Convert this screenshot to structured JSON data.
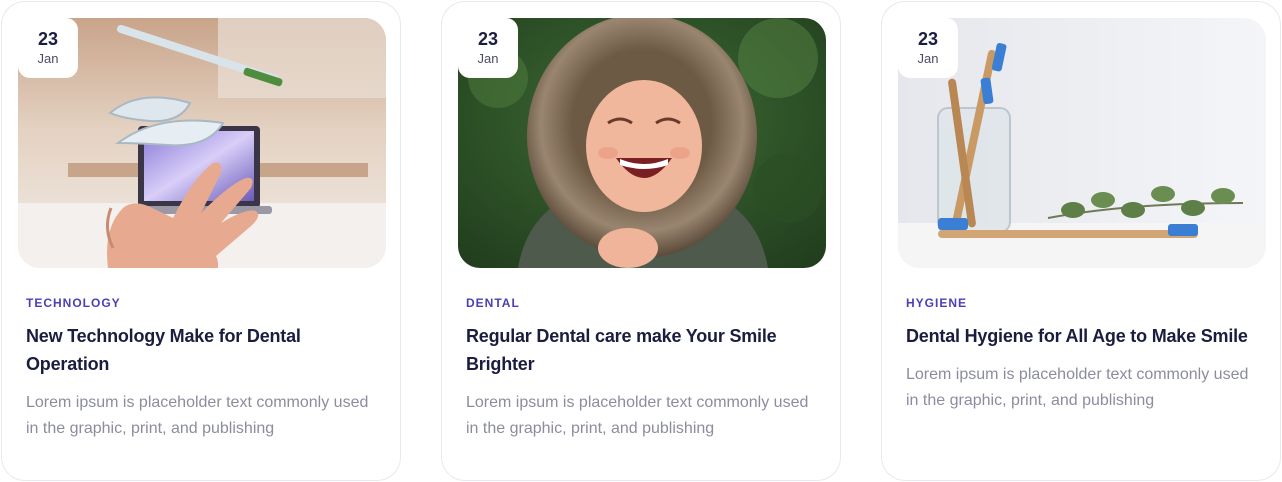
{
  "cards": [
    {
      "date": {
        "day": "23",
        "month": "Jan"
      },
      "category": "TECHNOLOGY",
      "title": "New Technology Make for Dental Operation",
      "excerpt": "Lorem ipsum is placeholder text commonly used in the graphic, print, and publishing"
    },
    {
      "date": {
        "day": "23",
        "month": "Jan"
      },
      "category": "DENTAL",
      "title": "Regular Dental care make Your Smile Brighter",
      "excerpt": "Lorem ipsum is placeholder text commonly used in the graphic, print, and publishing"
    },
    {
      "date": {
        "day": "23",
        "month": "Jan"
      },
      "category": "HYGIENE",
      "title": "Dental Hygiene for All Age to Make Smile",
      "excerpt": "Lorem ipsum is placeholder text commonly used in the graphic, print, and publishing"
    }
  ],
  "colors": {
    "category": "#4b3fb5",
    "title": "#1b1d3f",
    "excerpt": "#8b8d9e",
    "border": "#e8e8ee"
  }
}
